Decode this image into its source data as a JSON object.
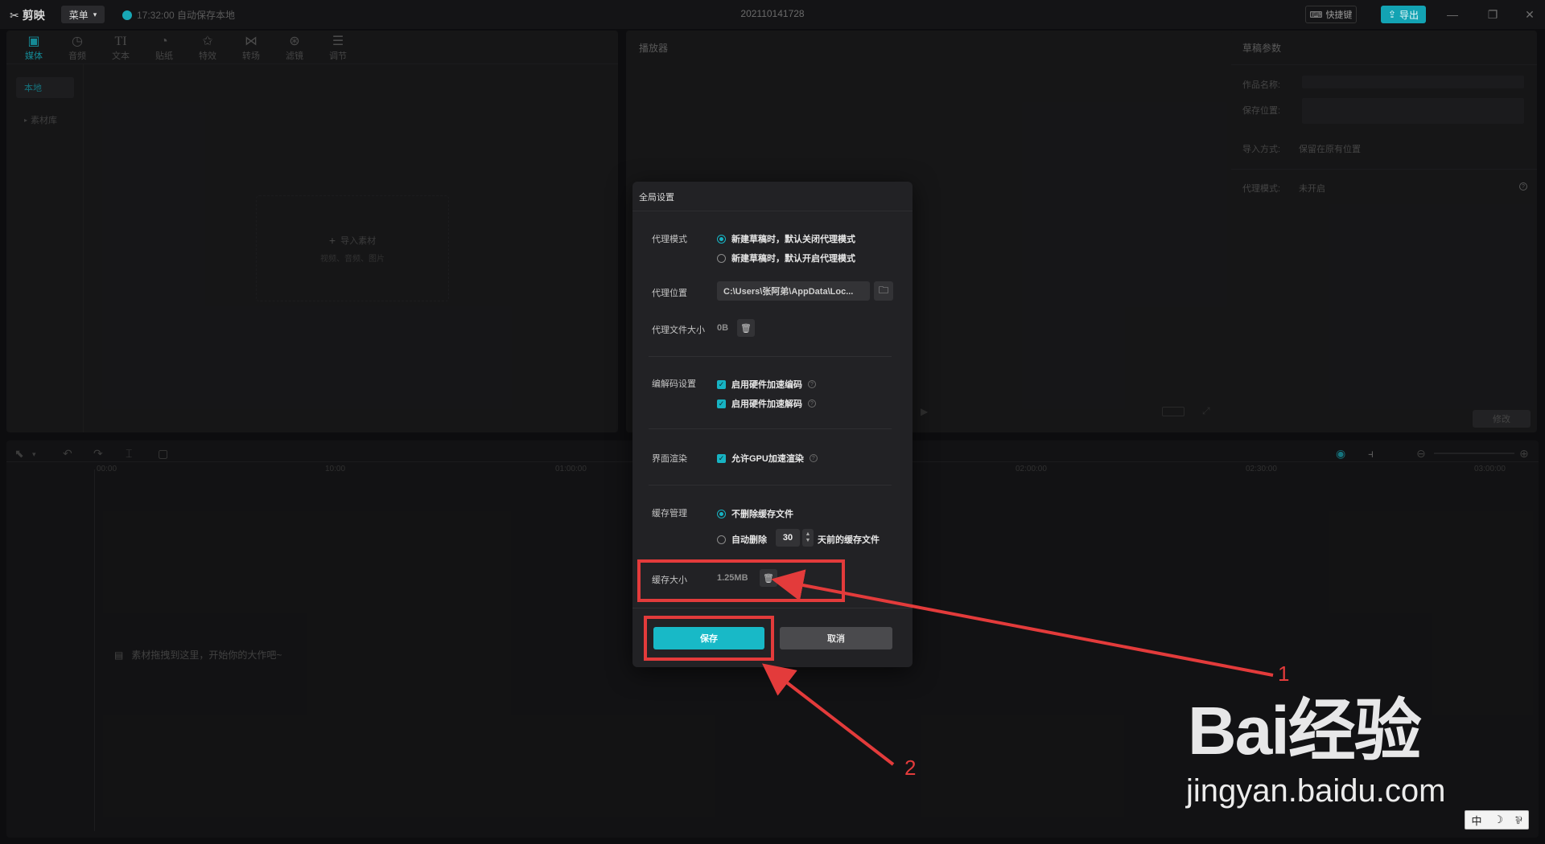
{
  "app": {
    "logo_text": "剪映",
    "menu_label": "菜单",
    "autosave_text": "17:32:00 自动保存本地",
    "project_title": "202110141728",
    "shortcut_label": "快捷键",
    "export_label": "导出"
  },
  "toolbar": {
    "tabs": [
      {
        "label": "媒体",
        "icon": "media-icon"
      },
      {
        "label": "音频",
        "icon": "audio-icon"
      },
      {
        "label": "文本",
        "icon": "text-icon"
      },
      {
        "label": "贴纸",
        "icon": "sticker-icon"
      },
      {
        "label": "特效",
        "icon": "effects-icon"
      },
      {
        "label": "转场",
        "icon": "transition-icon"
      },
      {
        "label": "滤镜",
        "icon": "filter-icon"
      },
      {
        "label": "调节",
        "icon": "adjust-icon"
      }
    ]
  },
  "media": {
    "sidebar": [
      "本地",
      "素材库"
    ],
    "import_label": "导入素材",
    "import_hint": "视频、音频、图片"
  },
  "player": {
    "title": "播放器"
  },
  "params": {
    "title": "草稿参数",
    "name_label": "作品名称:",
    "location_label": "保存位置:",
    "import_label": "导入方式:",
    "import_value": "保留在原有位置",
    "proxy_label": "代理模式:",
    "proxy_value": "未开启",
    "modify_label": "修改"
  },
  "timeline": {
    "ticks": [
      "00:00",
      "10:00",
      "01:00:00",
      "02:00:00",
      "02:30:00",
      "03:00:00"
    ],
    "drop_hint": "素材拖拽到这里，开始你的大作吧~"
  },
  "dialog": {
    "title": "全局设置",
    "proxy_mode": {
      "label": "代理模式",
      "options": [
        "新建草稿时，默认关闭代理模式",
        "新建草稿时，默认开启代理模式"
      ],
      "selected": 0
    },
    "proxy_location": {
      "label": "代理位置",
      "value": "C:\\Users\\张阿弟\\AppData\\Loc..."
    },
    "proxy_size": {
      "label": "代理文件大小",
      "value": "0B"
    },
    "codec": {
      "label": "编解码设置",
      "options": [
        "启用硬件加速编码",
        "启用硬件加速解码"
      ],
      "checked": [
        true,
        true
      ]
    },
    "render": {
      "label": "界面渲染",
      "option": "允许GPU加速渲染",
      "checked": true
    },
    "cache_mgmt": {
      "label": "缓存管理",
      "option_keep": "不删除缓存文件",
      "option_auto_prefix": "自动删除",
      "days": "30",
      "option_auto_suffix": "天前的缓存文件",
      "selected": 0
    },
    "cache_size": {
      "label": "缓存大小",
      "value": "1.25MB"
    },
    "save_label": "保存",
    "cancel_label": "取消"
  },
  "annotations": {
    "num1": "1",
    "num2": "2",
    "color": "#e33b3b"
  },
  "watermark": {
    "logo": "Bai经验",
    "url": "jingyan.baidu.com",
    "ime": [
      "中",
      "☽",
      "⅌"
    ]
  },
  "colors": {
    "accent": "#18b9c7",
    "background": "#111113",
    "panel": "#1b1b1d",
    "dialog": "#222225"
  }
}
